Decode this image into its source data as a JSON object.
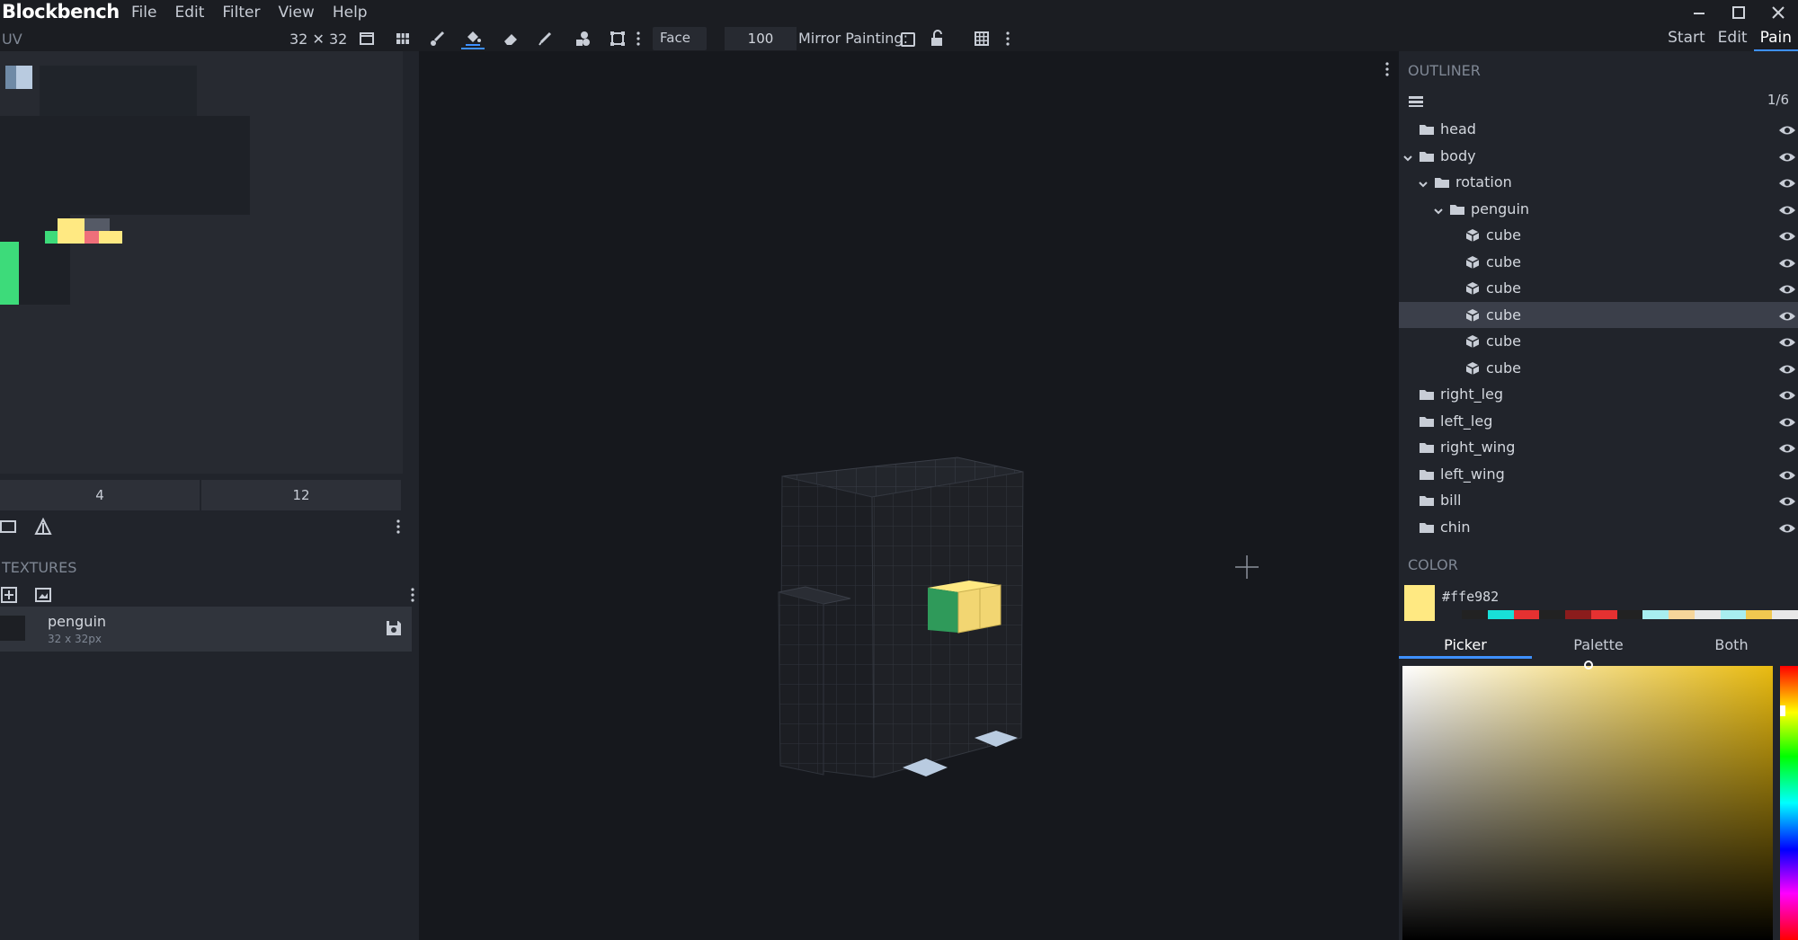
{
  "app": {
    "title": "Blockbench"
  },
  "menu": [
    "File",
    "Edit",
    "Filter",
    "View",
    "Help"
  ],
  "window_controls": [
    "minimize",
    "maximize",
    "close"
  ],
  "toolbar": {
    "uv_label": "UV",
    "uv_size": "32 ✕ 32",
    "face_select": "Face",
    "brush_size": "100",
    "mirror_label": "Mirror Painting:",
    "mirror_checked": false,
    "tools": [
      "fullscreen-icon",
      "grid-view-icon",
      "brush-icon",
      "fill-bucket-icon",
      "eraser-icon",
      "color-picker-icon",
      "shape-icon",
      "transform-icon",
      "lock-open-icon",
      "grid-icon"
    ]
  },
  "mode_tabs": [
    "Start",
    "Edit",
    "Pain"
  ],
  "active_mode": "Pain",
  "uv": {
    "values": [
      "4",
      "12"
    ]
  },
  "textures": {
    "title": "TEXTURES",
    "items": [
      {
        "name": "penguin",
        "dims": "32 x 32px"
      }
    ]
  },
  "outliner": {
    "title": "OUTLINER",
    "count": "1/6",
    "items": [
      {
        "label": "head",
        "type": "folder",
        "depth": 0,
        "expanded": null,
        "selected": false
      },
      {
        "label": "body",
        "type": "folder",
        "depth": 0,
        "expanded": true,
        "selected": false
      },
      {
        "label": "rotation",
        "type": "folder",
        "depth": 1,
        "expanded": true,
        "selected": false
      },
      {
        "label": "penguin",
        "type": "folder",
        "depth": 2,
        "expanded": true,
        "selected": false
      },
      {
        "label": "cube",
        "type": "cube",
        "depth": 3,
        "expanded": null,
        "selected": false
      },
      {
        "label": "cube",
        "type": "cube",
        "depth": 3,
        "expanded": null,
        "selected": false
      },
      {
        "label": "cube",
        "type": "cube",
        "depth": 3,
        "expanded": null,
        "selected": false
      },
      {
        "label": "cube",
        "type": "cube",
        "depth": 3,
        "expanded": null,
        "selected": true
      },
      {
        "label": "cube",
        "type": "cube",
        "depth": 3,
        "expanded": null,
        "selected": false
      },
      {
        "label": "cube",
        "type": "cube",
        "depth": 3,
        "expanded": null,
        "selected": false
      },
      {
        "label": "right_leg",
        "type": "folder",
        "depth": 0,
        "expanded": null,
        "selected": false
      },
      {
        "label": "left_leg",
        "type": "folder",
        "depth": 0,
        "expanded": null,
        "selected": false
      },
      {
        "label": "right_wing",
        "type": "folder",
        "depth": 0,
        "expanded": null,
        "selected": false
      },
      {
        "label": "left_wing",
        "type": "folder",
        "depth": 0,
        "expanded": null,
        "selected": false
      },
      {
        "label": "bill",
        "type": "folder",
        "depth": 0,
        "expanded": null,
        "selected": false
      },
      {
        "label": "chin",
        "type": "folder",
        "depth": 0,
        "expanded": null,
        "selected": false
      }
    ]
  },
  "color": {
    "title": "COLOR",
    "hex": "#ffe982",
    "tabs": [
      "Picker",
      "Palette",
      "Both"
    ],
    "active_tab": "Picker",
    "palette": [
      "#222222",
      "#18e0d8",
      "#e53131",
      "#222222",
      "#8b1c1c",
      "#e53131",
      "#222222",
      "#a8eef0",
      "#f6d59a",
      "#e8e8e8",
      "#a8eef0",
      "#f0c850",
      "#e8e8e8"
    ]
  }
}
